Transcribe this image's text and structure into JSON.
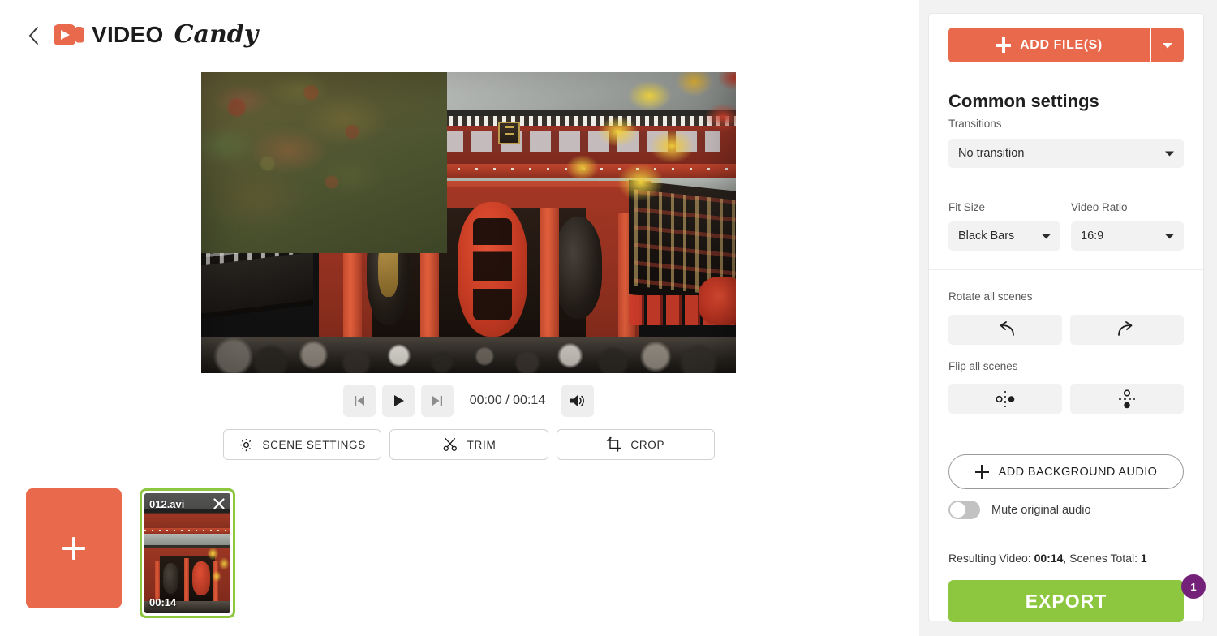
{
  "header": {
    "back_icon": "chevron-left-icon",
    "logo_icon": "video-camera-icon",
    "brand_primary": "VIDEO",
    "brand_secondary": "Candy"
  },
  "preview": {
    "scene_description": "Senso-ji temple gate in Asakusa with red pillars, large lanterns and autumn maple leaves"
  },
  "playback": {
    "prev_icon": "skip-previous-icon",
    "play_icon": "play-icon",
    "next_icon": "skip-next-icon",
    "time": "00:00 / 00:14",
    "current_time": "00:00",
    "total_time": "00:14",
    "volume_icon": "volume-on-icon"
  },
  "actions": [
    {
      "label": "SCENE SETTINGS",
      "icon": "gear-icon"
    },
    {
      "label": "TRIM",
      "icon": "scissors-icon"
    },
    {
      "label": "CROP",
      "icon": "crop-icon"
    }
  ],
  "timeline": {
    "add_tile_icon": "plus-icon",
    "scene": {
      "filename": "012.avi",
      "duration": "00:14",
      "close_icon": "close-icon",
      "selected_color": "#8dc63f"
    }
  },
  "panel": {
    "add_files": {
      "label": "ADD FILE(S)",
      "plus_icon": "plus-icon",
      "caret_icon": "chevron-down-icon",
      "color": "#e8694b"
    },
    "section_title": "Common settings",
    "transitions": {
      "label": "Transitions",
      "value": "No transition",
      "caret_icon": "chevron-down-icon"
    },
    "fit_size": {
      "label": "Fit Size",
      "value": "Black Bars",
      "caret_icon": "chevron-down-icon"
    },
    "video_ratio": {
      "label": "Video Ratio",
      "value": "16:9",
      "caret_icon": "chevron-down-icon"
    },
    "rotate": {
      "label": "Rotate all scenes",
      "left_icon": "rotate-left-icon",
      "right_icon": "rotate-right-icon"
    },
    "flip": {
      "label": "Flip all scenes",
      "horizontal_icon": "flip-horizontal-icon",
      "vertical_icon": "flip-vertical-icon"
    },
    "add_background_audio": {
      "label": "ADD BACKGROUND AUDIO",
      "plus_icon": "plus-icon"
    },
    "mute": {
      "label": "Mute original audio",
      "state": "off"
    },
    "result": {
      "prefix": "Resulting Video: ",
      "duration": "00:14",
      "middle": ", Scenes Total: ",
      "scenes_total": "1"
    },
    "export": {
      "label": "EXPORT",
      "color": "#8dc63f",
      "badge": "1",
      "badge_color": "#74217a"
    }
  }
}
